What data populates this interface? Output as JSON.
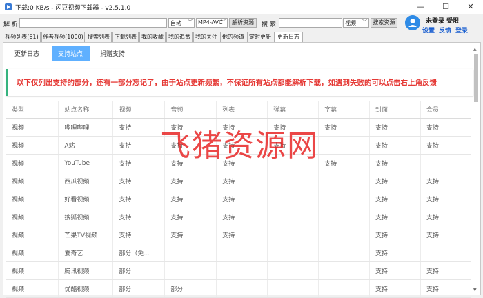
{
  "window": {
    "title": "下载:0 KB/s - 闪豆视频下载器 - v2.5.1.0",
    "minimize_glyph": "—",
    "maximize_glyph": "☐",
    "close_glyph": "✕"
  },
  "toolbar": {
    "parse_label": "解 析:",
    "parse_value": "",
    "quality_select": "自动",
    "format_select": "MP4-AVC",
    "parse_button": "解析资源",
    "search_label": "搜 索:",
    "search_value": "",
    "search_source_select": "视频",
    "search_button": "搜索资源"
  },
  "user": {
    "name": "未登录",
    "membership": "受限",
    "settings": "设置",
    "feedback": "反馈",
    "login": "登录"
  },
  "tabs": [
    "视频列表(61)",
    "作者视频(1000)",
    "搜索列表",
    "下载列表",
    "我的收藏",
    "我的追番",
    "我的关注",
    "他的频道",
    "定时更新",
    "更新日志"
  ],
  "active_tab": "更新日志",
  "subtabs": [
    "更新日志",
    "支持站点",
    "捐赠支持"
  ],
  "notice": "以下仅列出支持的部分，还有一部分忘记了，由于站点更新频繁，不保证所有站点都能解析下载，如遇到失败的可以点击右上角反馈",
  "table": {
    "headers": [
      "类型",
      "站点名称",
      "视频",
      "音频",
      "列表",
      "弹幕",
      "字幕",
      "封面",
      "会员"
    ],
    "rows": [
      [
        "视频",
        "哔哩哔哩",
        "支持",
        "支持",
        "支持",
        "支持",
        "支持",
        "支持",
        "支持"
      ],
      [
        "视频",
        "A站",
        "支持",
        "支持",
        "支持",
        "支持",
        "",
        "支持",
        "支持"
      ],
      [
        "视频",
        "YouTube",
        "支持",
        "支持",
        "支持",
        "",
        "支持",
        "支持",
        ""
      ],
      [
        "视频",
        "西瓜视频",
        "支持",
        "支持",
        "支持",
        "",
        "",
        "支持",
        "支持"
      ],
      [
        "视频",
        "好看视频",
        "支持",
        "支持",
        "支持",
        "",
        "",
        "支持",
        "支持"
      ],
      [
        "视频",
        "搜狐视频",
        "支持",
        "支持",
        "支持",
        "",
        "",
        "支持",
        "支持"
      ],
      [
        "视频",
        "芒果TV视频",
        "支持",
        "支持",
        "支持",
        "",
        "",
        "支持",
        "支持"
      ],
      [
        "视频",
        "爱奇艺",
        "部分（免...",
        "",
        "",
        "",
        "",
        "支持",
        ""
      ],
      [
        "视频",
        "腾讯视频",
        "部分",
        "",
        "",
        "",
        "",
        "支持",
        "支持"
      ],
      [
        "视频",
        "优酷视频",
        "部分",
        "部分",
        "",
        "",
        "",
        "支持",
        "支持"
      ]
    ]
  },
  "watermark": "飞猪资源网"
}
